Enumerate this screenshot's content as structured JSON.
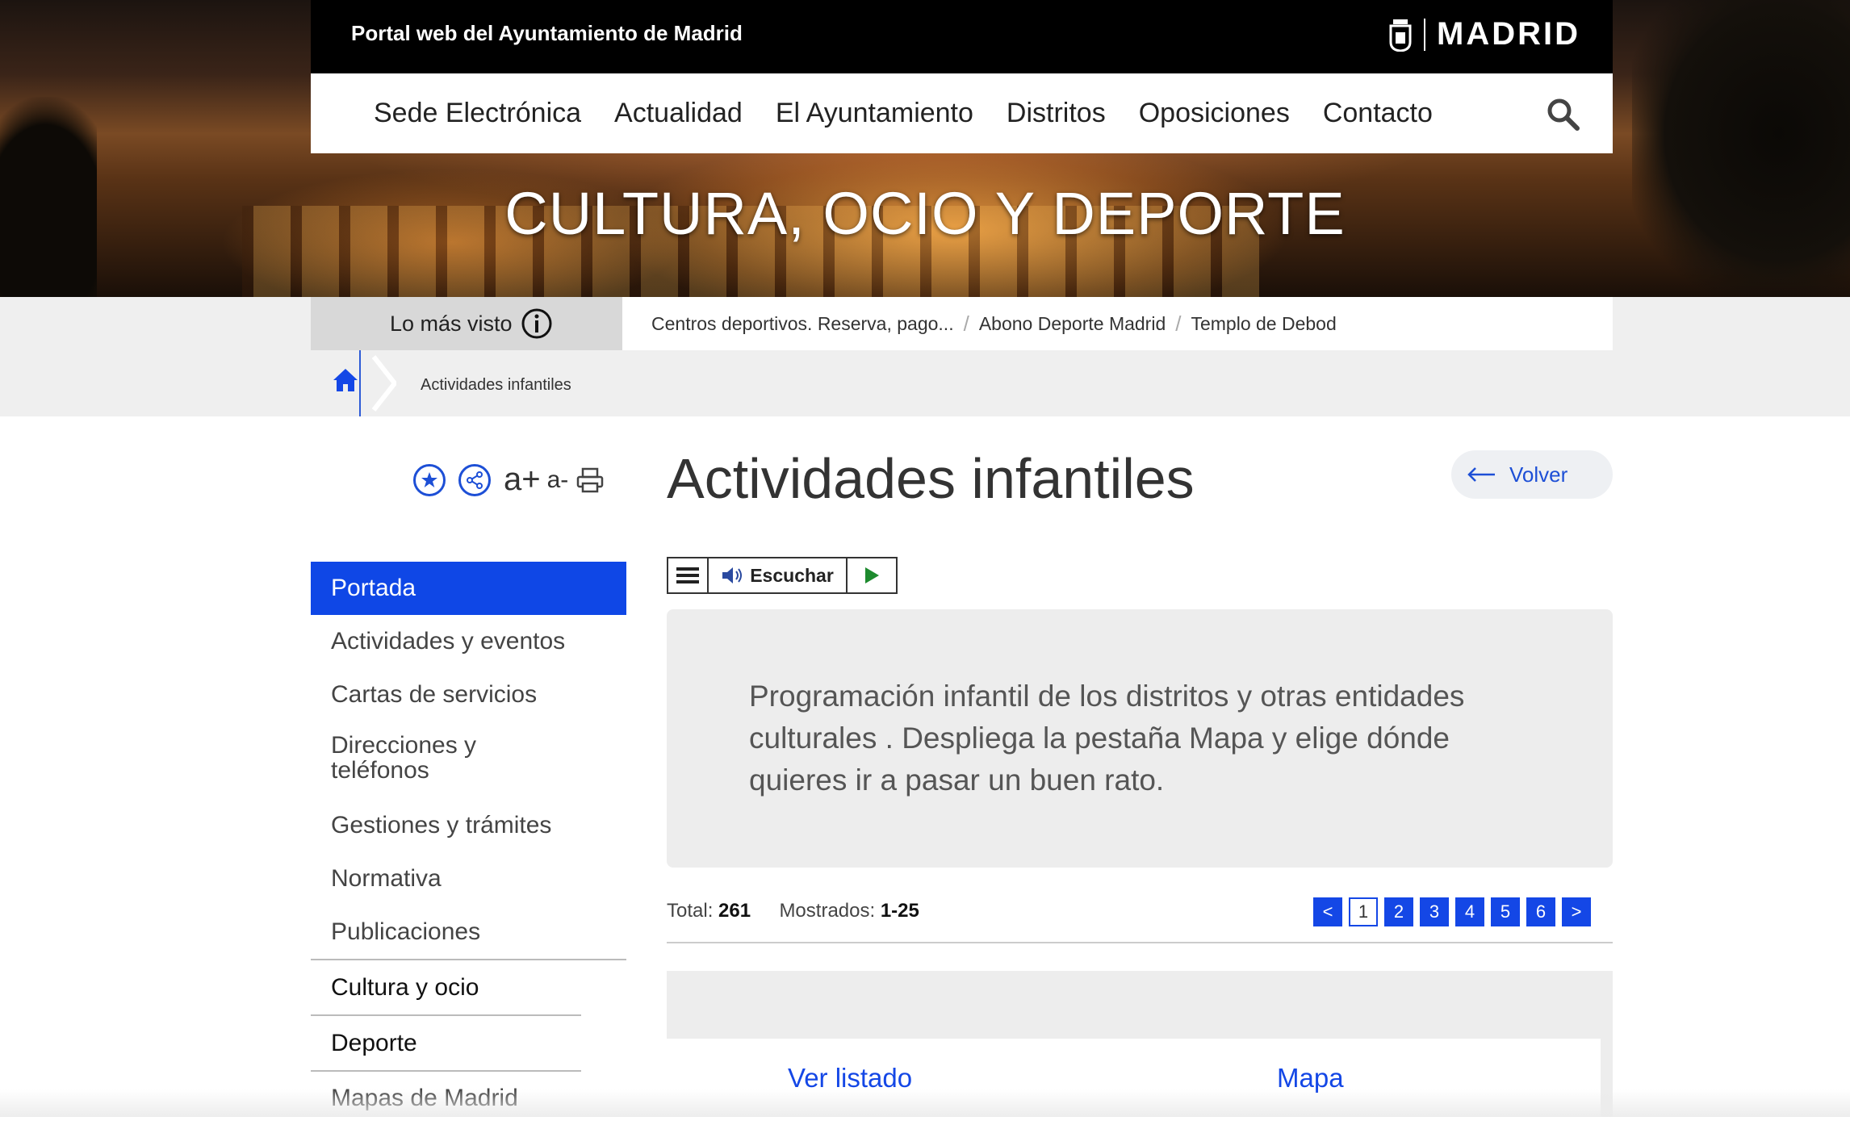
{
  "header": {
    "portal_title": "Portal web del Ayuntamiento de Madrid",
    "logo_text": "MADRID",
    "nav": [
      "Sede Electrónica",
      "Actualidad",
      "El Ayuntamiento",
      "Distritos",
      "Oposiciones",
      "Contacto"
    ],
    "section_title": "CULTURA, OCIO Y DEPORTE"
  },
  "most_viewed": {
    "label": "Lo más visto",
    "links": [
      "Centros deportivos. Reserva, pago...",
      "Abono Deporte Madrid",
      "Templo de Debod"
    ],
    "separator": "/"
  },
  "breadcrumb": {
    "current": "Actividades infantiles"
  },
  "tools": {
    "font_increase": "a+",
    "font_decrease": "a-"
  },
  "page": {
    "title": "Actividades infantiles",
    "back_label": "Volver"
  },
  "sidebar": {
    "items": [
      "Portada",
      "Actividades y eventos",
      "Cartas de servicios",
      "Direcciones y teléfonos",
      "Gestiones y trámites",
      "Normativa",
      "Publicaciones"
    ],
    "sections": [
      "Cultura y ocio",
      "Deporte",
      "Mapas de Madrid"
    ]
  },
  "player": {
    "listen_label": "Escuchar"
  },
  "intro": {
    "text": "Programación infantil de los distritos y otras entidades culturales . Despliega la pestaña Mapa y elige dónde quieres ir a pasar un buen rato."
  },
  "results": {
    "total_label": "Total:",
    "total": "261",
    "shown_label": "Mostrados:",
    "shown": "1-25"
  },
  "pagination": {
    "prev": "<",
    "next": ">",
    "pages": [
      "1",
      "2",
      "3",
      "4",
      "5",
      "6"
    ],
    "current": "1"
  },
  "tabs": [
    "Ver listado",
    "Mapa"
  ],
  "colors": {
    "accent": "#0f47e6",
    "header_bg": "#000000",
    "box_bg": "#ededed"
  }
}
